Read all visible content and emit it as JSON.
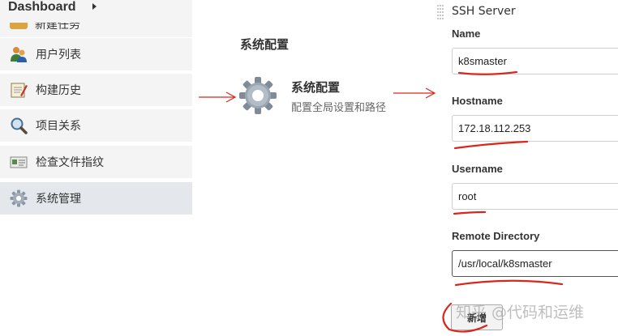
{
  "sidebar": {
    "title": "Dashboard",
    "partial_item": "新建任务",
    "items": [
      {
        "label": "用户列表",
        "icon": "users-icon"
      },
      {
        "label": "构建历史",
        "icon": "notepad-icon"
      },
      {
        "label": "项目关系",
        "icon": "magnifier-icon"
      },
      {
        "label": "检查文件指纹",
        "icon": "fingerprint-icon"
      },
      {
        "label": "系统管理",
        "icon": "gear-icon"
      }
    ]
  },
  "middle": {
    "section_title": "系统配置",
    "item_label": "系统配置",
    "item_desc": "配置全局设置和路径"
  },
  "form": {
    "section_title": "SSH Server",
    "name_label": "Name",
    "name_value": "k8smaster",
    "hostname_label": "Hostname",
    "hostname_value": "172.18.112.253",
    "username_label": "Username",
    "username_value": "root",
    "remote_dir_label": "Remote Directory",
    "remote_dir_value": "/usr/local/k8smaster",
    "add_button": "新增"
  },
  "watermark": "知乎 @代码和运维",
  "colors": {
    "annotation_red": "#d9261c",
    "sidebar_bg": "#f4f4f4",
    "sidebar_active": "#e4e8ec"
  }
}
